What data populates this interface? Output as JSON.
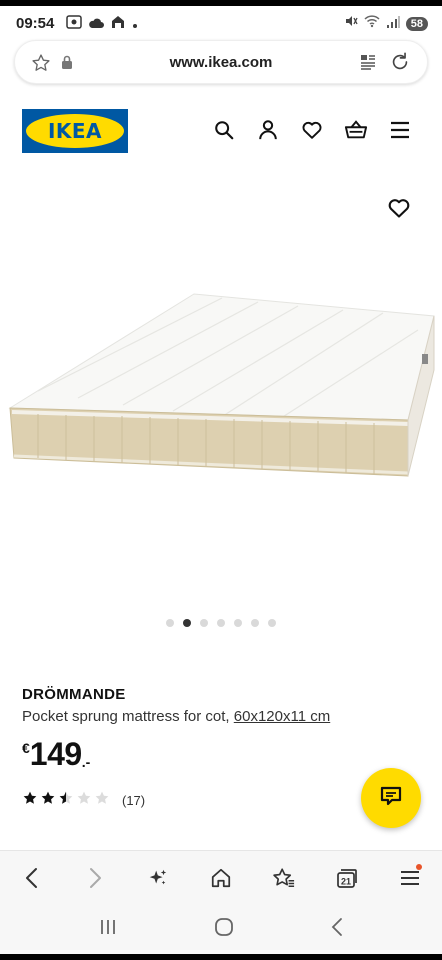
{
  "status_bar": {
    "time": "09:54",
    "battery": "58"
  },
  "browser": {
    "url": "www.ikea.com",
    "tab_count": "21"
  },
  "header": {
    "logo_text": "IKEA"
  },
  "product": {
    "brand": "DRÖMMANDE",
    "description": "Pocket sprung mattress for cot, ",
    "size_link": "60x120x11 cm",
    "currency": "€",
    "price": "149",
    "price_suffix": ".-",
    "rating_value": 2.5,
    "rating_max": 5,
    "review_count": "(17)"
  },
  "carousel": {
    "total": 7,
    "active": 2
  },
  "colors": {
    "ikea_blue": "#0058a3",
    "ikea_yellow": "#ffdb00"
  }
}
